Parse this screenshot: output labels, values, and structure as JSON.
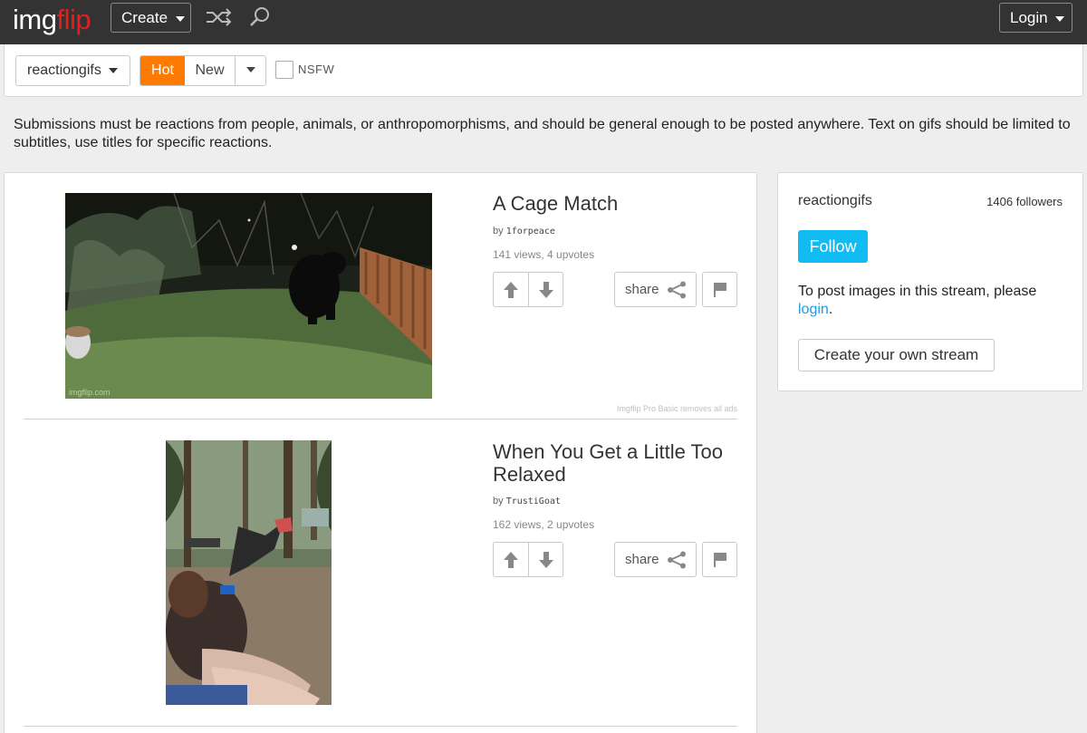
{
  "header": {
    "logo_part1": "img",
    "logo_part2": "flip",
    "create_label": "Create",
    "login_label": "Login"
  },
  "filter": {
    "stream_name": "reactiongifs",
    "hot_label": "Hot",
    "new_label": "New",
    "nsfw_label": "NSFW",
    "nsfw_checked": false
  },
  "description": "Submissions must be reactions from people, animals, or anthropomorphisms, and should be general enough to be posted anywhere. Text on gifs should be limited to subtitles, use titles for specific reactions.",
  "posts": [
    {
      "title": "A Cage Match",
      "by_prefix": "by",
      "author": "1forpeace",
      "stats": "141 views, 4 upvotes",
      "share_label": "share",
      "watermark": "imgflip.com"
    },
    {
      "title": "When You Get a Little Too Relaxed",
      "by_prefix": "by",
      "author": "TrustiGoat",
      "stats": "162 views, 2 upvotes",
      "share_label": "share"
    }
  ],
  "ad_note": "Imgflip Pro Basic removes all ads",
  "sidebar": {
    "stream_name": "reactiongifs",
    "followers": "1406 followers",
    "follow_label": "Follow",
    "post_text": "To post images in this stream, please",
    "login_link": "login",
    "post_text_end": ".",
    "create_stream_label": "Create your own stream"
  },
  "colors": {
    "header_bg": "#333333",
    "logo_accent": "#e02020",
    "hot_orange": "#ff7a00",
    "follow_blue": "#11bcf2",
    "link_blue": "#1a9ee6"
  },
  "icons": [
    "shuffle-icon",
    "search-icon",
    "chevron-down-icon",
    "upvote-icon",
    "downvote-icon",
    "share-icon",
    "flag-icon"
  ]
}
